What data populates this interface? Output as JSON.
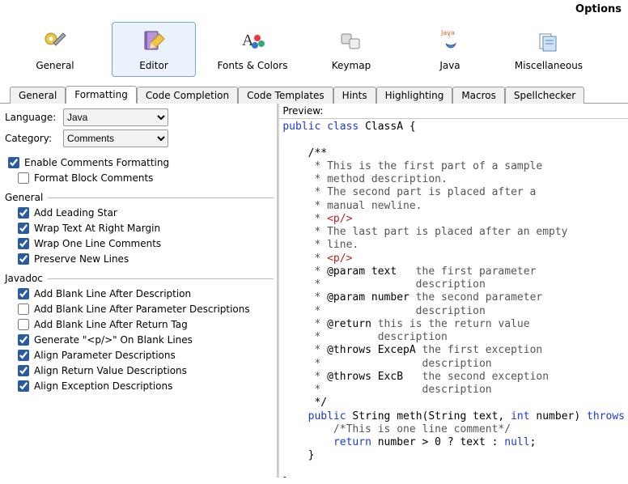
{
  "window": {
    "title": "Options"
  },
  "toolbar": {
    "items": [
      {
        "name": "general",
        "label": "General",
        "icon": "gear-wrench-icon"
      },
      {
        "name": "editor",
        "label": "Editor",
        "icon": "editor-icon",
        "selected": true
      },
      {
        "name": "fonts",
        "label": "Fonts & Colors",
        "icon": "palette-icon"
      },
      {
        "name": "keymap",
        "label": "Keymap",
        "icon": "keycap-icon"
      },
      {
        "name": "java",
        "label": "Java",
        "icon": "java-icon"
      },
      {
        "name": "misc",
        "label": "Miscellaneous",
        "icon": "misc-icon"
      }
    ]
  },
  "tabs": [
    "General",
    "Formatting",
    "Code Completion",
    "Code Templates",
    "Hints",
    "Highlighting",
    "Macros",
    "Spellchecker"
  ],
  "tabs_selected": "Formatting",
  "form": {
    "language_label": "Language:",
    "language_value": "Java",
    "category_label": "Category:",
    "category_value": "Comments",
    "enable_comments": "Enable Comments Formatting",
    "format_block": "Format Block Comments",
    "group_general": "General",
    "add_leading_star": "Add Leading Star",
    "wrap_right_margin": "Wrap Text At Right Margin",
    "wrap_one_line": "Wrap One Line Comments",
    "preserve_new_lines": "Preserve New Lines",
    "group_javadoc": "Javadoc",
    "blank_after_desc": "Add Blank Line After Description",
    "blank_after_param": "Add Blank Line After Parameter Descriptions",
    "blank_after_return": "Add Blank Line After Return Tag",
    "gen_p_blank": "Generate \"<p/>\" On Blank Lines",
    "align_param": "Align Parameter Descriptions",
    "align_return": "Align Return Value Descriptions",
    "align_exception": "Align Exception Descriptions"
  },
  "preview": {
    "label": "Preview:"
  }
}
